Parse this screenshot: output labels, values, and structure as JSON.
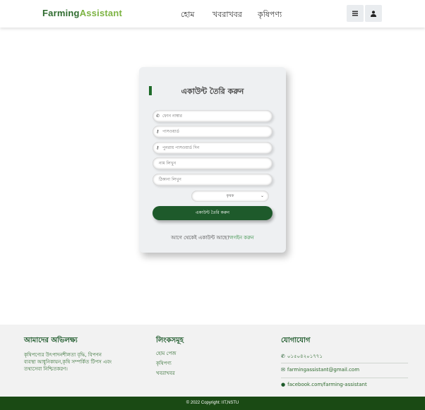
{
  "header": {
    "logo_part1": "Farming",
    "logo_part2": "Assistant",
    "nav": [
      "হোম",
      "খবরাখবর",
      "কৃষিপণ্য"
    ],
    "menu_icon": "bars-icon",
    "user_icon": "user-icon"
  },
  "form": {
    "title": "একাউন্ট তৈরি করুন",
    "phone_placeholder": "ফোন নাম্বার",
    "password_placeholder": "পাসওয়ার্ড",
    "confirm_password_placeholder": "পুনরায় পাসওয়ার্ড দিন",
    "name_placeholder": "নাম লিখুন",
    "address_placeholder": "ঠিকানা লিখুন",
    "role_selected": "কৃষক",
    "submit_label": "একাউন্ট তৈরি করুন",
    "login_prompt": "আগে থেকেই একাউন্ট আছে?",
    "login_link": "লগইন করুন"
  },
  "footer": {
    "about_title": "আমাদের অভিলক্ষ্য",
    "about_text": [
      "কৃষিপণ্যের উৎপাদনশীলতা বৃদ্ধি, বিপণন",
      "ব্যবস্থা আধুনিকায়ন,কৃষি সম্পর্কিত টিপস এবং",
      "তথ্যসেবা নিশ্চিতকরণ।"
    ],
    "links_title": "লিংকসমূহ",
    "links": [
      "হোম পেজ",
      "কৃষিপণ্য",
      "খবরাখবর"
    ],
    "contact_title": "যোগাযোগ",
    "phone": "০১৫০৪২০১৭৭১",
    "email": "farmingassistant@gmail.com",
    "facebook": "facebook.com/farming-assistant",
    "copyright": "© 2022 Copyright: IIT,NSTU"
  },
  "colors": {
    "brand_dark": "#1e5a2b",
    "brand_light": "#7cb342",
    "footer_bar": "#1a4a14"
  }
}
